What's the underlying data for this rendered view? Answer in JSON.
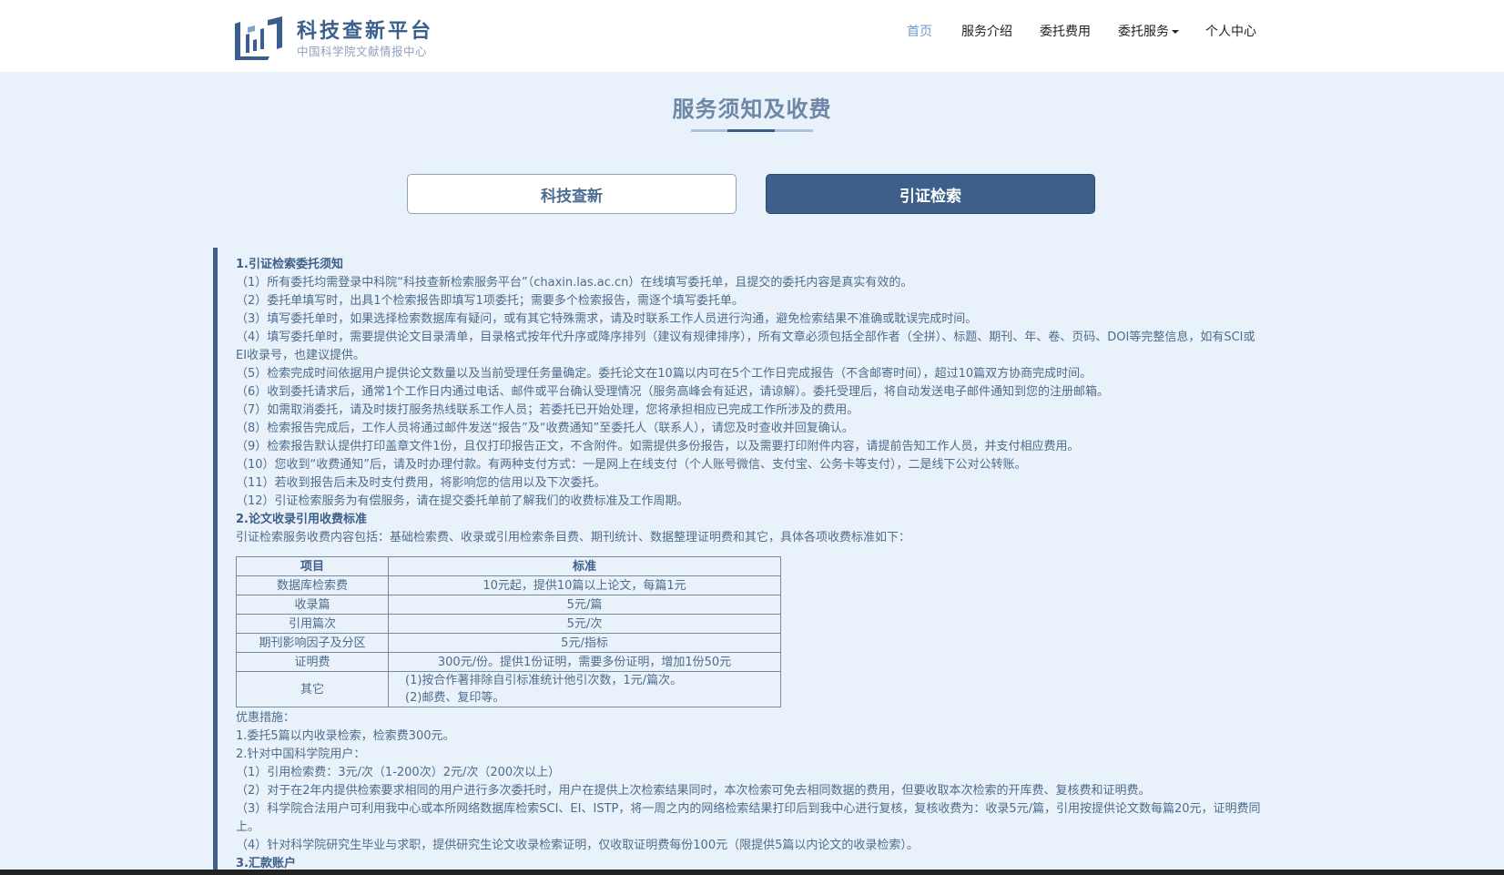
{
  "header": {
    "logo_title": "科技查新平台",
    "logo_subtitle": "中国科学院文献情报中心",
    "nav": [
      {
        "label": "首页",
        "active": true
      },
      {
        "label": "服务介绍",
        "active": false
      },
      {
        "label": "委托费用",
        "active": false
      },
      {
        "label": "委托服务",
        "active": false,
        "dropdown": true
      },
      {
        "label": "个人中心",
        "active": false
      }
    ]
  },
  "page": {
    "title": "服务须知及收费",
    "tabs": [
      {
        "label": "科技查新",
        "selected": false
      },
      {
        "label": "引证检索",
        "selected": true
      }
    ]
  },
  "section1": {
    "heading": "1.引证检索委托须知",
    "items": [
      "（1）所有委托均需登录中科院“科技查新检索服务平台”（chaxin.las.ac.cn）在线填写委托单，且提交的委托内容是真实有效的。",
      "（2）委托单填写时，出具1个检索报告即填写1项委托；需要多个检索报告，需逐个填写委托单。",
      "（3）填写委托单时，如果选择检索数据库有疑问，或有其它特殊需求，请及时联系工作人员进行沟通，避免检索结果不准确或耽误完成时间。",
      "（4）填写委托单时，需要提供论文目录清单，目录格式按年代升序或降序排列（建议有规律排序），所有文章必须包括全部作者（全拼）、标题、期刊、年、卷、页码、DOI等完整信息，如有SCI或EI收录号，也建议提供。",
      "（5）检索完成时间依据用户提供论文数量以及当前受理任务量确定。委托论文在10篇以内可在5个工作日完成报告（不含邮寄时间），超过10篇双方协商完成时间。",
      "（6）收到委托请求后，通常1个工作日内通过电话、邮件或平台确认受理情况（服务高峰会有延迟，请谅解）。委托受理后，将自动发送电子邮件通知到您的注册邮箱。",
      "（7）如需取消委托，请及时拨打服务热线联系工作人员；若委托已开始处理，您将承担相应已完成工作所涉及的费用。",
      "（8）检索报告完成后，工作人员将通过邮件发送“报告”及“收费通知”至委托人（联系人），请您及时查收并回复确认。",
      "（9）检索报告默认提供打印盖章文件1份，且仅打印报告正文，不含附件。如需提供多份报告，以及需要打印附件内容，请提前告知工作人员，并支付相应费用。",
      "（10）您收到“收费通知”后，请及时办理付款。有两种支付方式：一是网上在线支付（个人账号微信、支付宝、公务卡等支付），二是线下公对公转账。",
      "（11）若收到报告后未及时支付费用，将影响您的信用以及下次委托。",
      "（12）引证检索服务为有偿服务，请在提交委托单前了解我们的收费标准及工作周期。"
    ]
  },
  "section2": {
    "heading": "2.论文收录引用收费标准",
    "intro": "引证检索服务收费内容包括：基础检索费、收录或引用检索条目费、期刊统计、数据整理证明费和其它，具体各项收费标准如下：",
    "table": {
      "headers": [
        "项目",
        "标准"
      ],
      "rows": [
        [
          "数据库检索费",
          "10元起，提供10篇以上论文，每篇1元"
        ],
        [
          "收录篇",
          "5元/篇"
        ],
        [
          "引用篇次",
          "5元/次"
        ],
        [
          "期刊影响因子及分区",
          "5元/指标"
        ],
        [
          "证明费",
          "300元/份。提供1份证明，需要多份证明，增加1份50元"
        ]
      ],
      "other_label": "其它",
      "other_lines": [
        "(1)按合作著排除自引标准统计他引次数，1元/篇次。",
        "(2)邮费、复印等。"
      ]
    },
    "discount_heading": "优惠措施：",
    "discounts": [
      "1.委托5篇以内收录检索，检索费300元。",
      "2.针对中国科学院用户：",
      "（1）引用检索费：3元/次（1-200次）2元/次（200次以上）",
      "（2）对于在2年内提供检索要求相同的用户进行多次委托时，用户在提供上次检索结果同时，本次检索可免去相同数据的费用，但要收取本次检索的开库费、复核费和证明费。",
      "（3）科学院合法用户可利用我中心或本所网络数据库检索SCI、EI、ISTP，将一周之内的网络检索结果打印后到我中心进行复核，复核收费为：收录5元/篇，引用按提供论文数每篇20元，证明费同上。",
      "（4）针对科学院研究生毕业与求职，提供研究生论文收录检索证明，仅收取证明费每份100元（限提供5篇以内论文的收录检索）。"
    ]
  },
  "section3": {
    "heading": "3.汇款账户"
  },
  "colors": {
    "background": "#e9f1fa",
    "accent": "#3d5f89",
    "nav_active": "#6f9acb"
  }
}
